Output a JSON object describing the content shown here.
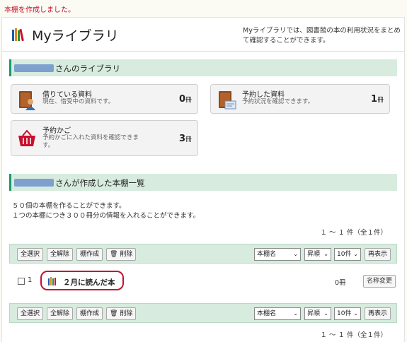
{
  "notice": "本棚を作成しました。",
  "header": {
    "title": "Myライブラリ",
    "description": "Myライブラリでは、図書館の本の利用状況をまとめて確認することができます。"
  },
  "library_section": {
    "title_suffix": "さんのライブラリ"
  },
  "cards": {
    "borrowed": {
      "title": "借りている資料",
      "subtitle": "現在、借受中の資料です。",
      "count": "0",
      "unit": "冊"
    },
    "reserved": {
      "title": "予約した資料",
      "subtitle": "予約状況を確認できます。",
      "count": "1",
      "unit": "冊"
    },
    "cart": {
      "title": "予約かご",
      "subtitle": "予約かごに入れた資料を確認できます。",
      "count": "3",
      "unit": "冊"
    }
  },
  "shelf_section": {
    "title_suffix": "さんが作成した本棚一覧",
    "info_line1": "５０個の本棚を作ることができます。",
    "info_line2": "１つの本棚につき３００冊分の情報を入れることができます。",
    "pager": "１ ～ １ 件（全１件）"
  },
  "toolbar": {
    "select_all": "全選択",
    "deselect_all": "全解除",
    "create_shelf": "棚作成",
    "delete": "削除",
    "sort_field": "本棚名",
    "sort_order": "昇順",
    "per_page": "10件",
    "redisplay": "再表示"
  },
  "shelves": [
    {
      "number": "1",
      "name": "２月に読んだ本",
      "count": "0冊",
      "rename_label": "名称変更"
    }
  ],
  "icons": {
    "header": "bookshelf-icon",
    "borrowed": "book-user-icon",
    "reserved": "book-card-icon",
    "cart": "basket-icon",
    "delete": "trash-icon"
  },
  "colors": {
    "accent": "#1a9a6b",
    "band": "#d7ebde",
    "notice": "#c8102e",
    "highlight": "#c8102e"
  }
}
